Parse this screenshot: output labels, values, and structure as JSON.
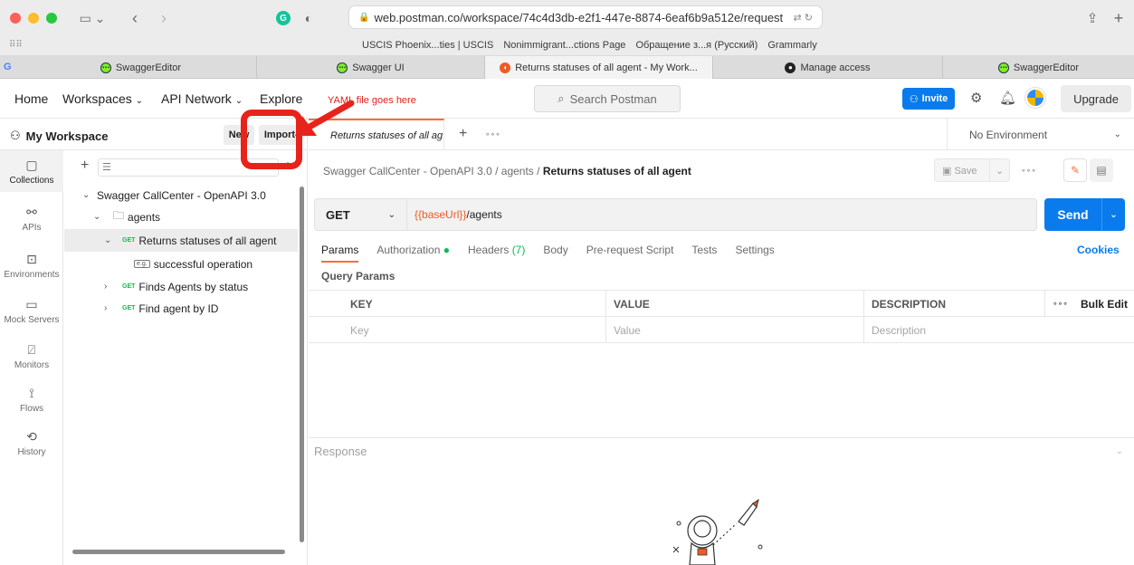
{
  "browser": {
    "url": "web.postman.co/workspace/74c4d3db-e2f1-447e-8874-6eaf6b9a512e/request",
    "bookmarks": [
      "USCIS Phoenix...ties | USCIS",
      "Nonimmigrant...ctions Page",
      "Обращение з...я (Русский)",
      "Grammarly"
    ],
    "tabs": [
      {
        "label": "SwaggerEditor",
        "icon": "swagger-icon"
      },
      {
        "label": "Swagger UI",
        "icon": "swagger-icon"
      },
      {
        "label": "Returns statuses of all agent - My Work...",
        "icon": "postman-icon"
      },
      {
        "label": "Manage access",
        "icon": "github-icon"
      },
      {
        "label": "SwaggerEditor",
        "icon": "swagger-icon"
      }
    ],
    "grammarly_badge": "G",
    "left_badge": "G"
  },
  "header": {
    "nav": [
      "Home",
      "Workspaces",
      "API Network",
      "Explore"
    ],
    "search_placeholder": "Search Postman",
    "invite_label": "Invite",
    "upgrade_label": "Upgrade"
  },
  "annotation": {
    "text": "YAML file goes here"
  },
  "workspace": {
    "title": "My Workspace",
    "new_label": "New",
    "import_label": "Import"
  },
  "rail": [
    {
      "label": "Collections",
      "icon": "collections-icon"
    },
    {
      "label": "APIs",
      "icon": "apis-icon"
    },
    {
      "label": "Environments",
      "icon": "environments-icon"
    },
    {
      "label": "Mock Servers",
      "icon": "mock-servers-icon"
    },
    {
      "label": "Monitors",
      "icon": "monitors-icon"
    },
    {
      "label": "Flows",
      "icon": "flows-icon"
    },
    {
      "label": "History",
      "icon": "history-icon"
    }
  ],
  "tree": {
    "collection": "Swagger CallCenter - OpenAPI 3.0",
    "folder": "agents",
    "requests": [
      {
        "method": "GET",
        "label": "Returns statuses of all agent"
      },
      {
        "method": "GET",
        "label": "Finds Agents by status"
      },
      {
        "method": "GET",
        "label": "Find agent by ID"
      }
    ],
    "example": "successful operation",
    "example_badge": "e.g."
  },
  "main": {
    "tab_label": "Returns statuses of all ag",
    "environment": "No Environment",
    "breadcrumb": [
      "Swagger CallCenter - OpenAPI 3.0",
      "agents",
      "Returns statuses of all agent"
    ],
    "save_label": "Save",
    "method": "GET",
    "url_var": "{{baseUrl}}",
    "url_path": "/agents",
    "send_label": "Send",
    "req_tabs": [
      "Params",
      "Authorization",
      "Headers",
      "Body",
      "Pre-request Script",
      "Tests",
      "Settings"
    ],
    "headers_count": "(7)",
    "cookies_label": "Cookies",
    "query_params_title": "Query Params",
    "table": {
      "headers": [
        "KEY",
        "VALUE",
        "DESCRIPTION"
      ],
      "bulk_edit": "Bulk Edit",
      "placeholders": [
        "Key",
        "Value",
        "Description"
      ]
    },
    "response_label": "Response"
  },
  "colors": {
    "accent_orange": "#ff6c37",
    "primary_blue": "#097bed",
    "get_green": "#0cbb52",
    "annotation_red": "#e8231b"
  }
}
